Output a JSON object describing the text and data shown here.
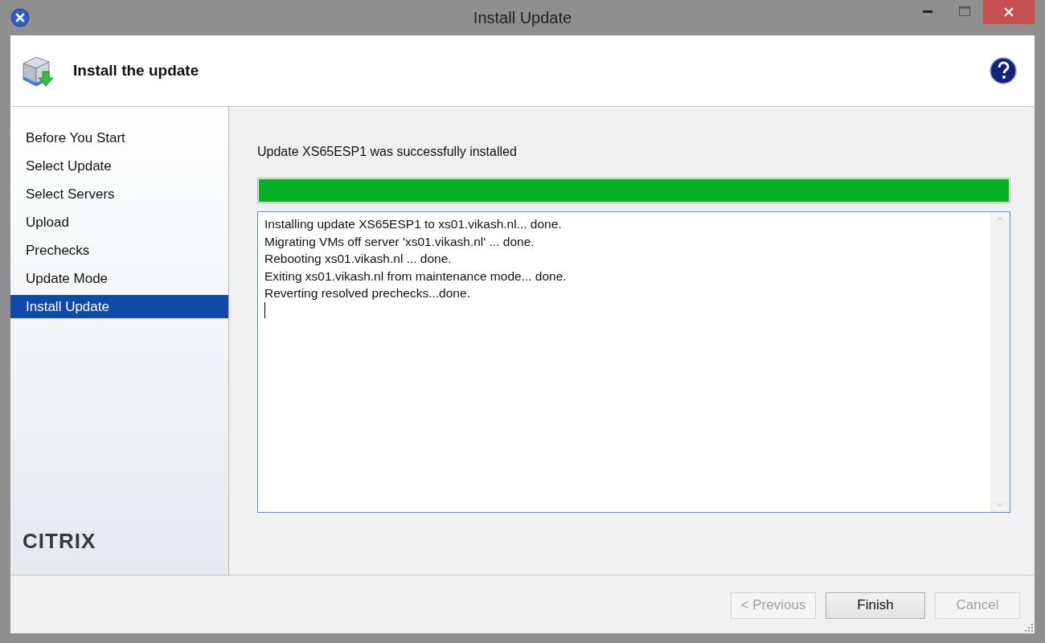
{
  "window": {
    "title": "Install Update"
  },
  "header": {
    "title": "Install the update"
  },
  "sidebar": {
    "items": [
      {
        "label": "Before You Start",
        "selected": false
      },
      {
        "label": "Select Update",
        "selected": false
      },
      {
        "label": "Select Servers",
        "selected": false
      },
      {
        "label": "Upload",
        "selected": false
      },
      {
        "label": "Prechecks",
        "selected": false
      },
      {
        "label": "Update Mode",
        "selected": false
      },
      {
        "label": "Install Update",
        "selected": true
      }
    ],
    "logo": "CITRIX"
  },
  "status": {
    "message": "Update XS65ESP1 was successfully installed",
    "level": 1
  },
  "log": {
    "lines": [
      "Installing update XS65ESP1 to xs01.vikash.nl... done.",
      "Migrating VMs off server 'xs01.vikash.nl' ... done.",
      "Rebooting xs01.vikash.nl ... done.",
      "Exiting xs01.vikash.nl from maintenance mode... done.",
      "Reverting resolved prechecks...done."
    ]
  },
  "buttons": [
    {
      "label": "< Previous",
      "disabled": true
    },
    {
      "label": "Finish",
      "disabled": false
    },
    {
      "label": "Cancel",
      "disabled": true
    }
  ]
}
